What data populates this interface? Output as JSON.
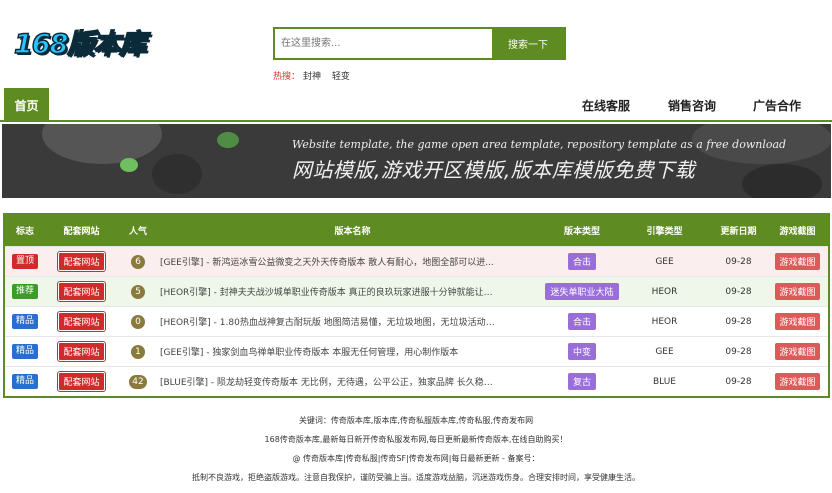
{
  "logo": "168版本库",
  "search": {
    "placeholder": "在这里搜索...",
    "button": "搜索一下"
  },
  "hot": {
    "label": "热搜：",
    "items": [
      "封神",
      "轻变"
    ]
  },
  "nav": {
    "home": "首页",
    "links": [
      "在线客服",
      "销售咨询",
      "广告合作"
    ]
  },
  "banner": {
    "english": "Website template, the game open area template, repository template as a free download",
    "chinese": "网站模版,游戏开区模版,版本库模版免费下载"
  },
  "table": {
    "headers": [
      "标志",
      "配套网站",
      "人气",
      "版本名称",
      "版本类型",
      "引擎类型",
      "更新日期",
      "游戏截图"
    ],
    "rows": [
      {
        "tag": "置顶",
        "tag_color": "#d02b2b",
        "site": "配套网站",
        "pop": "6",
        "title": "[GEE引擎] - 新鸿运冰雪公益微变之天外天传奇版本 散人有耐心，地图全部可以进...",
        "type": "合击",
        "type_color": "#9a6ed8",
        "engine": "GEE",
        "date": "09-28",
        "shot": "游戏截图"
      },
      {
        "tag": "推荐",
        "tag_color": "#3e9b2a",
        "site": "配套网站",
        "pop": "5",
        "title": "[HEOR引擎] - 封神夫夫战沙城单职业传奇版本 真正的良玖玩家进服十分钟就能让您...",
        "type": "迷失单职业大陆",
        "type_color": "#9a6ed8",
        "engine": "HEOR",
        "date": "09-28",
        "shot": "游戏截图"
      },
      {
        "tag": "精品",
        "tag_color": "#2a6fd0",
        "site": "配套网站",
        "pop": "0",
        "title": "[HEOR引擎] - 1.80热血战神复古耐玩版 地图简洁易懂，无垃圾地图，无垃圾活动！...",
        "type": "合击",
        "type_color": "#9a6ed8",
        "engine": "HEOR",
        "date": "09-28",
        "shot": "游戏截图"
      },
      {
        "tag": "精品",
        "tag_color": "#2a6fd0",
        "site": "配套网站",
        "pop": "1",
        "title": "[GEE引擎] - 独家剑血鸟禅单职业传奇版本 本服无任何管理，用心制作版本",
        "type": "中变",
        "type_color": "#9a6ed8",
        "engine": "GEE",
        "date": "09-28",
        "shot": "游戏截图"
      },
      {
        "tag": "精品",
        "tag_color": "#2a6fd0",
        "site": "配套网站",
        "pop": "42",
        "title": "[BLUE引擎] - 陨龙劫轻变传奇版本 无比例，无待遇，公平公正，独家品牌 长久稳定...",
        "type": "复古",
        "type_color": "#9a6ed8",
        "engine": "BLUE",
        "date": "09-28",
        "shot": "游戏截图"
      }
    ]
  },
  "footer": {
    "lines": [
      "关键词：传奇版本库,版本库,传奇私服版本库,传奇私服,传奇发布网",
      "168传奇版本库,最新每日新开传奇私服发布网,每日更新最新传奇版本,在线自助购买！",
      "@ 传奇版本库|传奇私服|传奇SF|传奇发布网|每日最新更新 - 备案号：",
      "抵制不良游戏，拒绝盗版游戏。注意自我保护，谨防受骗上当。适度游戏益脑，沉迷游戏伤身。合理安排时间，享受健康生活。"
    ]
  }
}
